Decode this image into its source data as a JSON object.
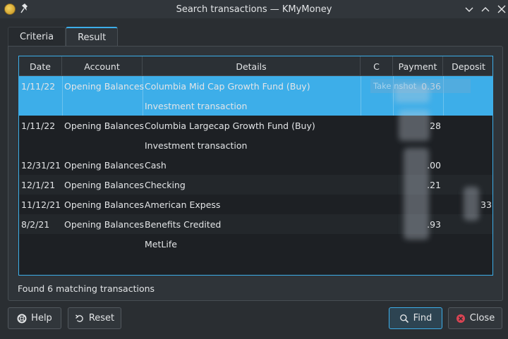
{
  "window": {
    "title": "Search transactions — KMyMoney"
  },
  "tabs": [
    {
      "label": "Criteria",
      "active": false
    },
    {
      "label": "Result",
      "active": true
    }
  ],
  "table": {
    "columns": [
      "Date",
      "Account",
      "Details",
      "C",
      "Payment",
      "Deposit"
    ],
    "rows": [
      {
        "date": "1/11/22",
        "account": "Opening Balances",
        "details": "Columbia Mid Cap Growth Fund (Buy)",
        "payment": "0.36",
        "deposit": "",
        "selected": true
      },
      {
        "date": "",
        "account": "",
        "details": "Investment transaction",
        "payment": "",
        "deposit": "",
        "selected": true
      },
      {
        "date": "1/11/22",
        "account": "Opening Balances",
        "details": "Columbia  Largecap Growth Fund (Buy)",
        "payment": "28",
        "deposit": ""
      },
      {
        "date": "",
        "account": "",
        "details": "Investment transaction",
        "payment": "",
        "deposit": ""
      },
      {
        "date": "12/31/21",
        "account": "Opening Balances",
        "details": "Cash",
        "payment": ".00",
        "deposit": ""
      },
      {
        "date": "12/1/21",
        "account": "Opening Balances",
        "details": "Checking",
        "payment": ".21",
        "deposit": ""
      },
      {
        "date": "11/12/21",
        "account": "Opening Balances",
        "details": "American Expess",
        "payment": "",
        "deposit": "33"
      },
      {
        "date": "8/2/21",
        "account": "Opening Balances",
        "details": "Benefits Credited",
        "payment": ".93",
        "deposit": ""
      },
      {
        "date": "",
        "account": "",
        "details": "MetLife",
        "payment": "",
        "deposit": ""
      }
    ],
    "ghost_text": "Take        nshot"
  },
  "status": {
    "text": "Found 6 matching transactions"
  },
  "buttons": {
    "help": "Help",
    "reset": "Reset",
    "find": "Find",
    "close": "Close"
  },
  "colors": {
    "accent": "#3daee9",
    "background": "#2a2e32",
    "table": "#1d2024",
    "close_icon": "#da4453"
  }
}
